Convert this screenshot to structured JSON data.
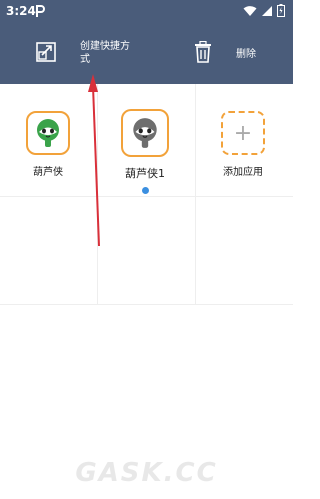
{
  "status": {
    "time": "3:24",
    "app_icon": "p-icon"
  },
  "action_bar": {
    "shortcut_label": "创建快捷方式",
    "delete_label": "删除"
  },
  "apps": [
    {
      "label": "葫芦侠",
      "icon": "gourd-green-icon"
    },
    {
      "label": "葫芦侠1",
      "icon": "gourd-gray-icon",
      "selected": true
    },
    {
      "label": "添加应用",
      "icon": "add-icon"
    }
  ],
  "watermark": "GASK.CC",
  "colors": {
    "header_bg": "#4a5c7a",
    "accent_border": "#f2a23a",
    "selected_dot": "#3b8fe0",
    "annotation_arrow": "#d9303a"
  }
}
